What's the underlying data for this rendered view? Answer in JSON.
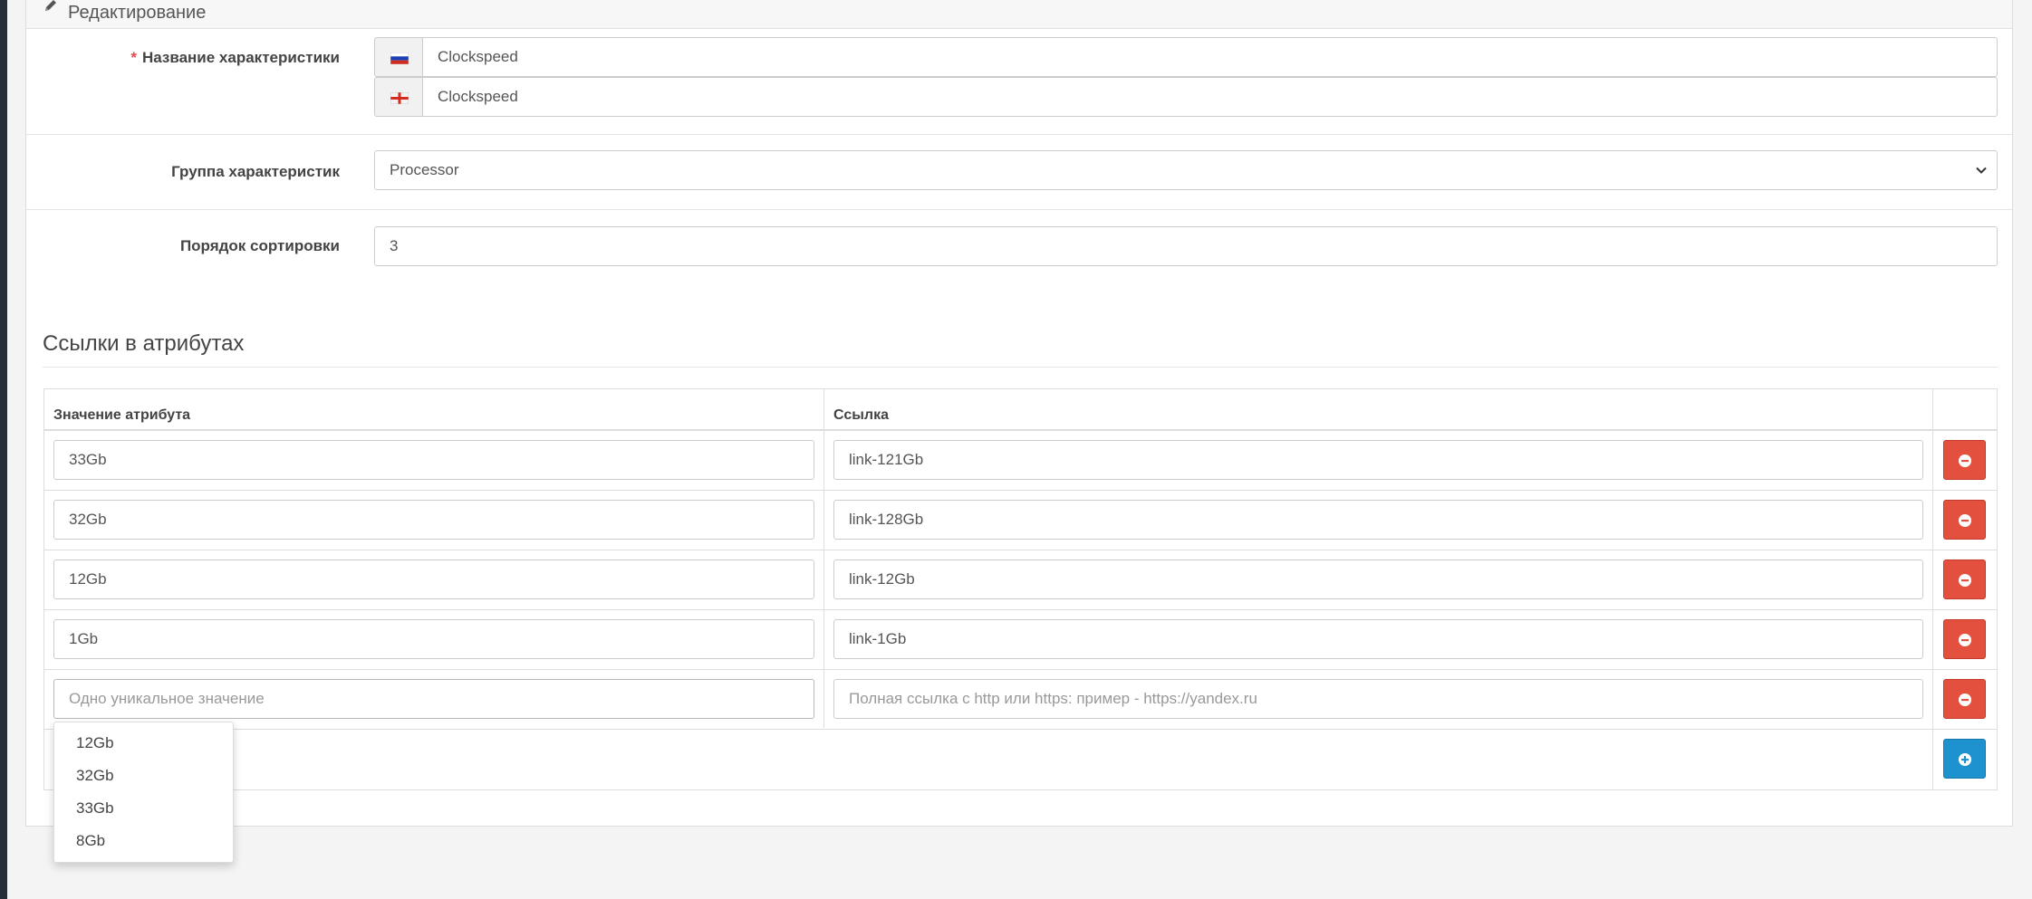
{
  "panel": {
    "title": "Редактирование",
    "icon": "pencil-icon"
  },
  "form": {
    "name": {
      "label": "Название характеристики",
      "required_mark": "*",
      "values": [
        {
          "flag": "ru-flag-icon",
          "value": "Clockspeed"
        },
        {
          "flag": "en-flag-icon",
          "value": "Clockspeed"
        }
      ]
    },
    "group": {
      "label": "Группа характеристик",
      "selected": "Processor"
    },
    "sort_order": {
      "label": "Порядок сортировки",
      "value": "3"
    }
  },
  "links_section": {
    "title": "Ссылки в атрибутах",
    "columns": [
      "Значение атрибута",
      "Ссылка"
    ],
    "rows": [
      {
        "attr": "33Gb",
        "link": "link-121Gb"
      },
      {
        "attr": "32Gb",
        "link": "link-128Gb"
      },
      {
        "attr": "12Gb",
        "link": "link-12Gb"
      },
      {
        "attr": "1Gb",
        "link": "link-1Gb"
      }
    ],
    "new_row": {
      "attr_placeholder": "Одно уникальное значение",
      "link_placeholder": "Полная ссылка с http или https: пример - https://yandex.ru"
    },
    "remove_icon": "minus-circle-icon",
    "add_icon": "plus-circle-icon"
  },
  "autocomplete": [
    "12Gb",
    "32Gb",
    "33Gb",
    "8Gb"
  ],
  "colors": {
    "danger": "#e3503e",
    "primary": "#1e91cf",
    "required": "#e8474a"
  }
}
